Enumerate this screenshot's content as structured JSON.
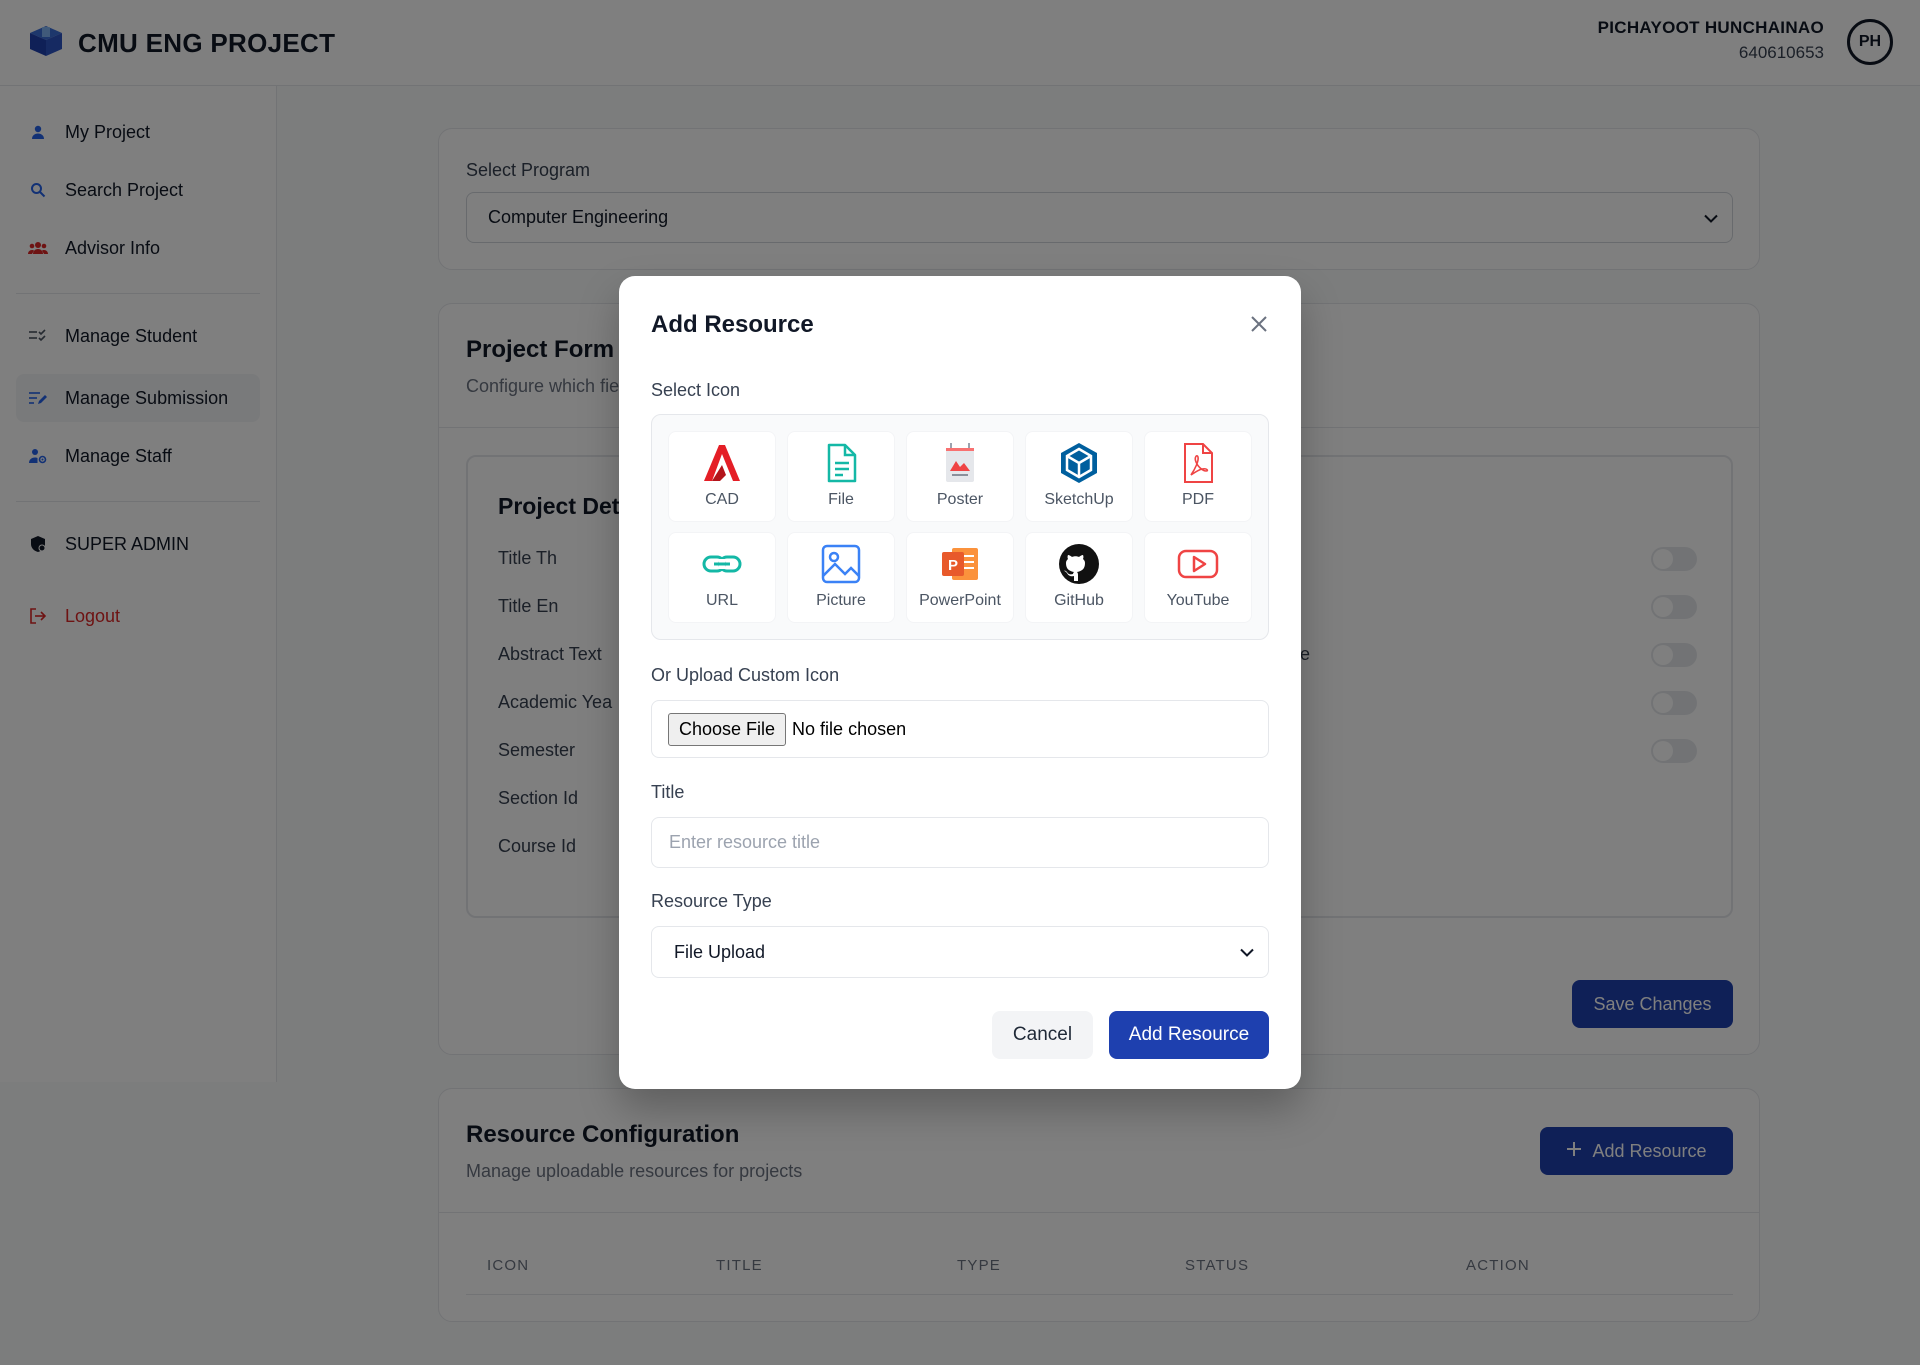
{
  "header": {
    "brand": "CMU ENG PROJECT",
    "user_name": "PICHAYOOT HUNCHAINAO",
    "user_id": "640610653",
    "avatar_initials": "PH"
  },
  "sidebar": {
    "items": [
      {
        "label": "My Project",
        "icon": "user-icon"
      },
      {
        "label": "Search Project",
        "icon": "search-icon"
      },
      {
        "label": "Advisor Info",
        "icon": "users-icon"
      },
      {
        "label": "Manage Student",
        "icon": "list-check-icon"
      },
      {
        "label": "Manage Submission",
        "icon": "edit-list-icon",
        "active": true
      },
      {
        "label": "Manage Staff",
        "icon": "user-gear-icon"
      },
      {
        "label": "SUPER ADMIN",
        "icon": "shield-icon"
      },
      {
        "label": "Logout",
        "icon": "logout-icon"
      }
    ]
  },
  "program": {
    "label": "Select Program",
    "selected": "Computer Engineering"
  },
  "form_config": {
    "title_partial": "Project Form C",
    "subtitle_partial": "Configure which fie",
    "section_title_partial": "Project Det",
    "fields": [
      "Title Th",
      "Title En",
      "Abstract Text",
      "Academic Yea",
      "Semester",
      "Section Id",
      "Course Id"
    ],
    "right_partial": "ee",
    "save_label": "Save Changes"
  },
  "resource_config": {
    "title": "Resource Configuration",
    "subtitle": "Manage uploadable resources for projects",
    "add_label": "Add Resource",
    "columns": [
      "ICON",
      "TITLE",
      "TYPE",
      "STATUS",
      "ACTION"
    ]
  },
  "modal": {
    "title": "Add Resource",
    "select_icon_label": "Select Icon",
    "icons": [
      "CAD",
      "File",
      "Poster",
      "SketchUp",
      "PDF",
      "URL",
      "Picture",
      "PowerPoint",
      "GitHub",
      "YouTube"
    ],
    "upload_label": "Or Upload Custom Icon",
    "choose_file": "Choose File",
    "no_file": "No file chosen",
    "title_label": "Title",
    "title_placeholder": "Enter resource title",
    "type_label": "Resource Type",
    "type_selected": "File Upload",
    "cancel": "Cancel",
    "submit": "Add Resource"
  },
  "colors": {
    "primary": "#1e40af",
    "danger": "#dc2626",
    "overlay": "rgba(0,0,0,0.5)"
  }
}
